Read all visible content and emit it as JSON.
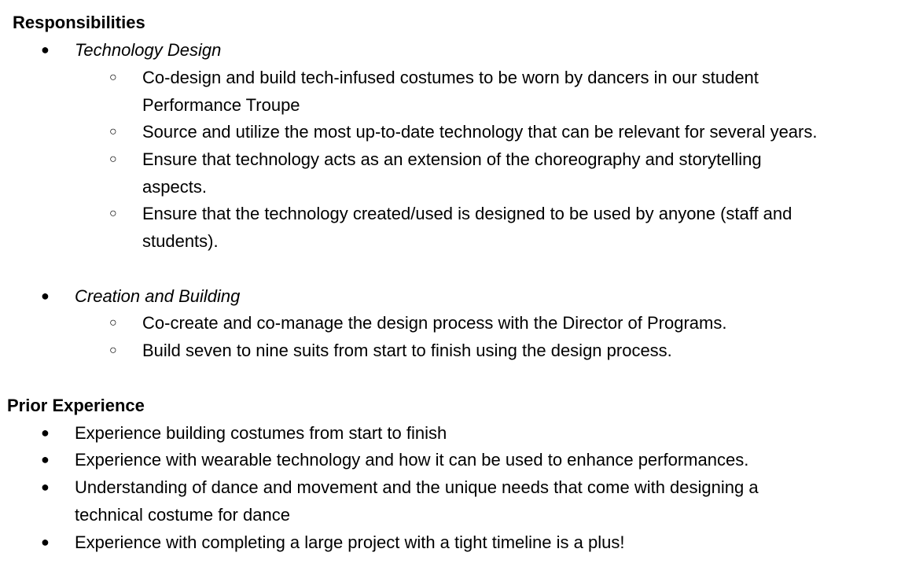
{
  "responsibilities": {
    "heading": "Responsibilities",
    "groups": [
      {
        "label": "Technology Design",
        "items": [
          {
            "lines": [
              "Co-design and build tech-infused costumes to be worn by dancers in our student",
              "Performance Troupe"
            ]
          },
          {
            "lines": [
              "Source and utilize the most up-to-date technology that can be relevant for several years."
            ]
          },
          {
            "lines": [
              "Ensure that technology acts as an extension of the choreography and storytelling",
              "aspects."
            ]
          },
          {
            "lines": [
              "Ensure that the technology created/used is designed to be used by anyone (staff and",
              "students)."
            ]
          }
        ]
      },
      {
        "label": "Creation and Building",
        "items": [
          {
            "lines": [
              "Co-create and co-manage the design process with the Director of Programs."
            ]
          },
          {
            "lines": [
              "Build seven to nine suits from start to finish using the design process."
            ]
          }
        ]
      }
    ]
  },
  "prior_experience": {
    "heading": "Prior Experience",
    "items": [
      {
        "lines": [
          "Experience building costumes from start to finish"
        ]
      },
      {
        "lines": [
          "Experience with wearable technology and how it can be used to enhance performances."
        ]
      },
      {
        "lines": [
          "Understanding of dance and movement and the unique needs that come with designing a",
          "technical costume for dance"
        ]
      },
      {
        "lines": [
          "Experience with completing a large project with a tight timeline is a plus!"
        ]
      }
    ]
  },
  "bullets": {
    "filled": "●",
    "hollow": "○"
  }
}
